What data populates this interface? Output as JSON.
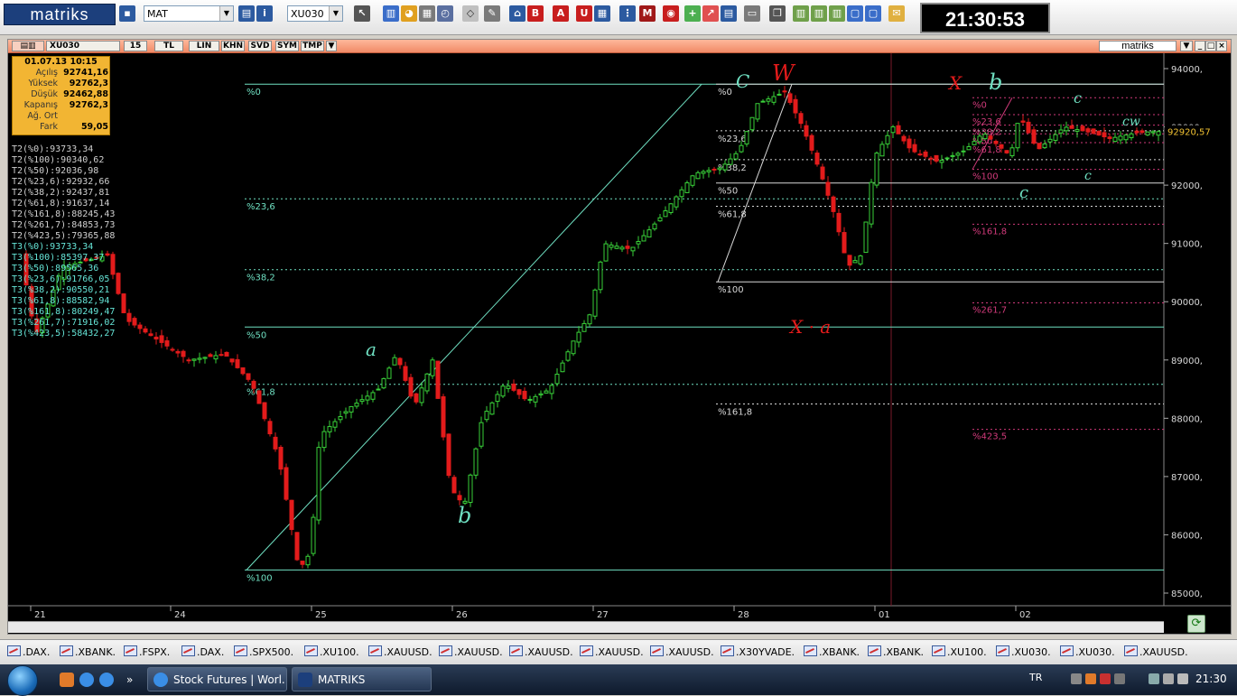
{
  "toolbar": {
    "logo": "matriks",
    "mode_combo": "MAT",
    "symbol_combo": "XU030",
    "clock": "21:30:53"
  },
  "chart_window": {
    "symbol": "XU030",
    "buttons": [
      "15",
      "TL",
      "LIN",
      "KHN",
      "SVD",
      "SYM",
      "TMP"
    ],
    "brand": "matriks"
  },
  "ohlc_box": {
    "datetime": "01.07.13 10:15",
    "rows": [
      {
        "label": "Açılış",
        "value": "92741,16"
      },
      {
        "label": "Yüksek",
        "value": "92762,3"
      },
      {
        "label": "Düşük",
        "value": "92462,88"
      },
      {
        "label": "Kapanış",
        "value": "92762,3"
      },
      {
        "label": "Ağ. Ort",
        "value": ""
      },
      {
        "label": "Fark",
        "value": "59,05"
      }
    ]
  },
  "fib_list": [
    "T2(%0):93733,34",
    "T2(%100):90340,62",
    "T2(%50):92036,98",
    "T2(%23,6):92932,66",
    "T2(%38,2):92437,81",
    "T2(%61,8):91637,14",
    "T2(%161,8):88245,43",
    "T2(%261,7):84853,73",
    "T2(%423,5):79365,88",
    "T3(%0):93733,34",
    "T3(%100):85397,37",
    "T3(%50):89565,36",
    "T3(%23,6):91766,05",
    "T3(%38,2):90550,21",
    "T3(%61,8):88582,94",
    "T3(%161,8):80249,47",
    "T3(%261,7):71916,02",
    "T3(%423,5):58432,27"
  ],
  "colors": {
    "t2": "#d0d0d0",
    "t3": "#66e6d8",
    "up": "#39d139",
    "down": "#e31b1b",
    "fib_green": "#6fe0c2",
    "fib_pink": "#d03a7a",
    "last_price_bg": "#f1c232"
  },
  "chart_data": {
    "type": "candlestick",
    "x_labels": [
      "21",
      "24",
      "25",
      "26",
      "27",
      "28",
      "01",
      "02"
    ],
    "y_ticks": [
      "94000,",
      "93000,",
      "92000,",
      "91000,",
      "90000,",
      "89000,",
      "88000,",
      "87000,",
      "86000,",
      "85000,"
    ],
    "ylim": [
      85000,
      94000
    ],
    "last_price": "92920,57",
    "fib_levels_left": [
      {
        "label": "%0",
        "y": 93733
      },
      {
        "label": "%23,6",
        "y": 91766
      },
      {
        "label": "%38,2",
        "y": 90550
      },
      {
        "label": "%50",
        "y": 89565
      },
      {
        "label": "%61,8",
        "y": 88583
      },
      {
        "label": "%100",
        "y": 85397
      }
    ],
    "fib_levels_mid": [
      {
        "label": "%0",
        "y": 93733
      },
      {
        "label": "%23,6",
        "y": 92933
      },
      {
        "label": "%38,2",
        "y": 92438
      },
      {
        "label": "%50",
        "y": 92037
      },
      {
        "label": "%61,8",
        "y": 91637
      },
      {
        "label": "%100",
        "y": 90341
      },
      {
        "label": "%161,8",
        "y": 88245
      }
    ],
    "fib_levels_right": [
      {
        "label": "%0",
        "y": 93500
      },
      {
        "label": "%23,6",
        "y": 93210
      },
      {
        "label": "%38,2",
        "y": 93030
      },
      {
        "label": "%50",
        "y": 92880
      },
      {
        "label": "%61,8",
        "y": 92730
      },
      {
        "label": "%100",
        "y": 92270
      },
      {
        "label": "%161,8",
        "y": 91330
      },
      {
        "label": "%261,7",
        "y": 89980
      },
      {
        "label": "%423,5",
        "y": 87810
      }
    ],
    "annotations": [
      "C",
      "W",
      "X",
      "b",
      "a",
      "X · a",
      "b",
      "c",
      "c",
      "cw",
      "c"
    ]
  },
  "symbol_tabs": [
    ".DAX.",
    ".XBANK.",
    ".FSPX.",
    ".DAX.",
    ".SPX500.",
    ".XU100.",
    ".XAUUSD.",
    ".XAUUSD.",
    ".XAUUSD.",
    ".XAUUSD.",
    ".XAUUSD.",
    ".X30YVADE.",
    ".XBANK.",
    ".XBANK.",
    ".XU100.",
    ".XU030.",
    ".XU030.",
    ".XAUUSD."
  ],
  "taskbar": {
    "apps": [
      "Stock Futures | Worl...",
      "MATRIKS"
    ],
    "lang": "TR",
    "time": "21:30"
  }
}
